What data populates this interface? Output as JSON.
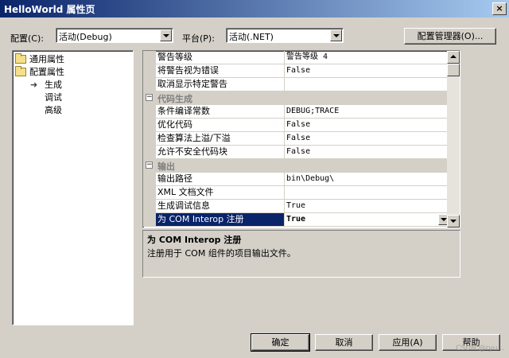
{
  "window": {
    "title": "HelloWorld 属性页",
    "close_glyph": "×"
  },
  "toolbar": {
    "config_label": "配置(C):",
    "config_value": "活动(Debug)",
    "platform_label": "平台(P):",
    "platform_value": "活动(.NET)",
    "config_manager_label": "配置管理器(O)..."
  },
  "tree": {
    "items": [
      {
        "label": "通用属性"
      },
      {
        "label": "配置属性"
      },
      {
        "label": "生成"
      },
      {
        "label": "调试"
      },
      {
        "label": "高级"
      }
    ],
    "current_marker": "➜"
  },
  "grid": {
    "rows": [
      {
        "name": "警告等级",
        "value": "警告等级 4"
      },
      {
        "name": "将警告视为错误",
        "value": "False"
      },
      {
        "name": "取消显示特定警告",
        "value": ""
      },
      {
        "category": "代码生成",
        "toggle": "⊟"
      },
      {
        "name": "条件编译常数",
        "value": "DEBUG;TRACE"
      },
      {
        "name": "优化代码",
        "value": "False"
      },
      {
        "name": "检查算法上溢/下溢",
        "value": "False"
      },
      {
        "name": "允许不安全代码块",
        "value": "False"
      },
      {
        "category": "输出",
        "toggle": "⊟"
      },
      {
        "name": "输出路径",
        "value": "bin\\Debug\\"
      },
      {
        "name": "XML 文档文件",
        "value": ""
      },
      {
        "name": "生成调试信息",
        "value": "True"
      },
      {
        "name": "为 COM Interop 注册",
        "value": "True",
        "selected": true
      }
    ]
  },
  "description": {
    "title": "为 COM Interop 注册",
    "text": "注册用于 COM 组件的项目输出文件。"
  },
  "buttons": {
    "ok": "确定",
    "cancel": "取消",
    "apply": "应用(A)",
    "help": "帮助"
  },
  "watermark": "CSDN @ryu..."
}
